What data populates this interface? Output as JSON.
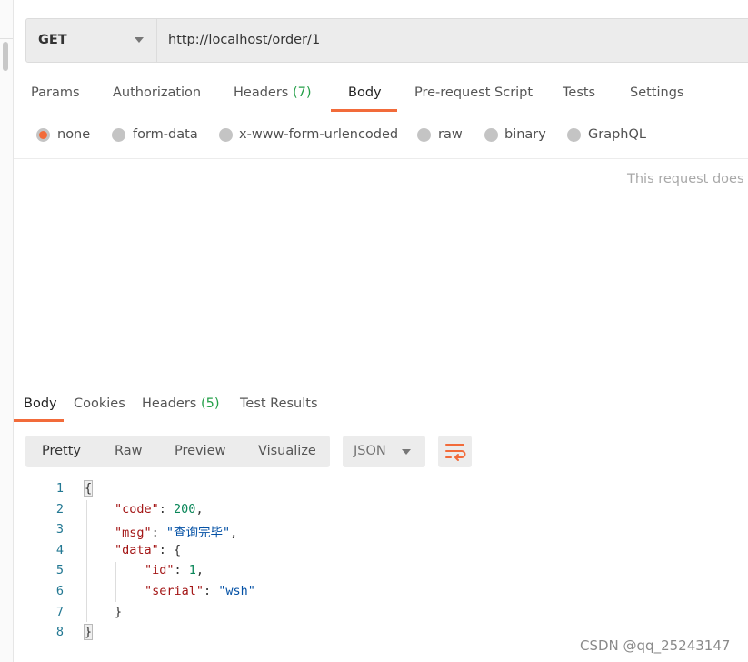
{
  "request": {
    "method": "GET",
    "url": "http://localhost/order/1"
  },
  "tabs": [
    {
      "label": "Params"
    },
    {
      "label": "Authorization"
    },
    {
      "label": "Headers",
      "count": "(7)"
    },
    {
      "label": "Body",
      "active": true
    },
    {
      "label": "Pre-request Script"
    },
    {
      "label": "Tests"
    },
    {
      "label": "Settings"
    }
  ],
  "body_types": [
    {
      "label": "none",
      "selected": true
    },
    {
      "label": "form-data"
    },
    {
      "label": "x-www-form-urlencoded"
    },
    {
      "label": "raw"
    },
    {
      "label": "binary"
    },
    {
      "label": "GraphQL"
    }
  ],
  "no_body_message": "This request does n",
  "response": {
    "tabs": [
      {
        "label": "Body",
        "active": true
      },
      {
        "label": "Cookies"
      },
      {
        "label": "Headers",
        "count": "(5)"
      },
      {
        "label": "Test Results"
      }
    ],
    "views": [
      "Pretty",
      "Raw",
      "Preview",
      "Visualize"
    ],
    "format": "JSON",
    "wrap_icon": "wrap-lines-icon",
    "lines": [
      {
        "n": "1",
        "parts": [
          [
            "p",
            "{"
          ]
        ]
      },
      {
        "n": "2",
        "parts": [
          [
            "k",
            "\"code\""
          ],
          [
            "p",
            ": "
          ],
          [
            "n",
            "200"
          ],
          [
            "p",
            ","
          ]
        ]
      },
      {
        "n": "3",
        "parts": [
          [
            "k",
            "\"msg\""
          ],
          [
            "p",
            ": "
          ],
          [
            "s",
            "\"查询完毕\""
          ],
          [
            "p",
            ","
          ]
        ]
      },
      {
        "n": "4",
        "parts": [
          [
            "k",
            "\"data\""
          ],
          [
            "p",
            ": {"
          ]
        ]
      },
      {
        "n": "5",
        "parts": [
          [
            "k",
            "\"id\""
          ],
          [
            "p",
            ": "
          ],
          [
            "n",
            "1"
          ],
          [
            "p",
            ","
          ]
        ]
      },
      {
        "n": "6",
        "parts": [
          [
            "k",
            "\"serial\""
          ],
          [
            "p",
            ": "
          ],
          [
            "s",
            "\"wsh\""
          ]
        ]
      },
      {
        "n": "7",
        "parts": [
          [
            "p",
            "}"
          ]
        ]
      },
      {
        "n": "8",
        "parts": [
          [
            "p",
            "}"
          ]
        ]
      }
    ]
  },
  "watermark": "CSDN @qq_25243147",
  "colors": {
    "accent": "#f26b3a",
    "count": "#26a04a",
    "key": "#a31515",
    "number": "#098658",
    "string": "#0451a5"
  }
}
